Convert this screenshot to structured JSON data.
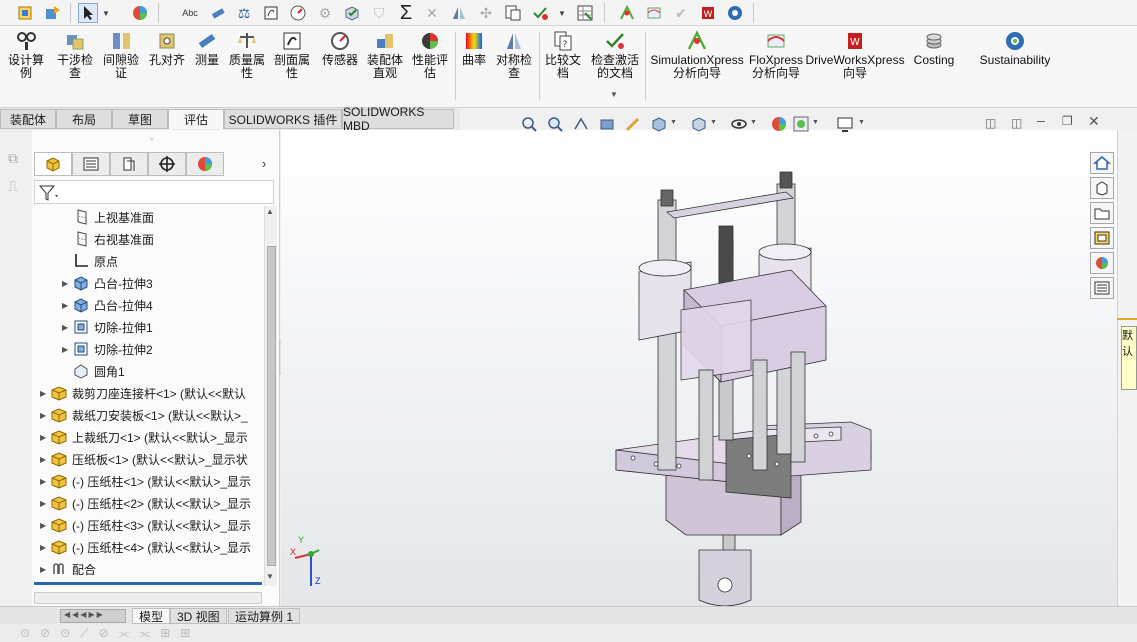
{
  "ribbon": {
    "buttons": [
      {
        "label": "设计算\n例",
        "icon": "design-study-icon"
      },
      {
        "label": "干涉检\n查",
        "icon": "interference-detection-icon"
      },
      {
        "label": "间隙验\n证",
        "icon": "clearance-verification-icon"
      },
      {
        "label": "孔对齐",
        "icon": "hole-alignment-icon"
      },
      {
        "label": "测量",
        "icon": "measure-icon"
      },
      {
        "label": "质量属\n性",
        "icon": "mass-properties-icon"
      },
      {
        "label": "剖面属\n性",
        "icon": "section-properties-icon"
      },
      {
        "label": "传感器",
        "icon": "sensor-icon"
      },
      {
        "label": "装配体\n直观",
        "icon": "assembly-visualization-icon"
      },
      {
        "label": "性能评\n估",
        "icon": "performance-evaluation-icon"
      },
      {
        "label": "曲率",
        "icon": "curvature-icon"
      },
      {
        "label": "对称检\n查",
        "icon": "symmetry-check-icon"
      },
      {
        "label": "比较文\n档",
        "icon": "compare-documents-icon"
      },
      {
        "label": "检查激活\n的文档",
        "icon": "check-active-document-icon"
      },
      {
        "label": "SimulationXpress\n分析向导",
        "icon": "simulationxpress-icon"
      },
      {
        "label": "FloXpress\n分析向导",
        "icon": "floxpress-icon"
      },
      {
        "label": "DriveWorksXpress\n向导",
        "icon": "driveworksxpress-icon"
      },
      {
        "label": "Costing",
        "icon": "costing-icon"
      },
      {
        "label": "Sustainability",
        "icon": "sustainability-icon"
      }
    ]
  },
  "tabs": [
    {
      "label": "装配体"
    },
    {
      "label": "布局"
    },
    {
      "label": "草图"
    },
    {
      "label": "评估",
      "active": true
    },
    {
      "label": "SOLIDWORKS 插件"
    },
    {
      "label": "SOLIDWORKS MBD"
    }
  ],
  "tree": [
    {
      "label": "上视基准面",
      "icon": "plane-icon",
      "expander": false,
      "indent": 1
    },
    {
      "label": "右视基准面",
      "icon": "plane-icon",
      "expander": false,
      "indent": 1
    },
    {
      "label": "原点",
      "icon": "origin-icon",
      "expander": false,
      "indent": 1
    },
    {
      "label": "凸台-拉伸3",
      "icon": "boss-extrude-icon",
      "expander": true,
      "indent": 1
    },
    {
      "label": "凸台-拉伸4",
      "icon": "boss-extrude-icon",
      "expander": true,
      "indent": 1
    },
    {
      "label": "切除-拉伸1",
      "icon": "cut-extrude-icon",
      "expander": true,
      "indent": 1
    },
    {
      "label": "切除-拉伸2",
      "icon": "cut-extrude-icon",
      "expander": true,
      "indent": 1
    },
    {
      "label": "圆角1",
      "icon": "fillet-icon",
      "expander": false,
      "indent": 1
    },
    {
      "label": "裁剪刀座连接杆<1> (默认<<默认",
      "icon": "part-icon",
      "expander": true,
      "indent": 0
    },
    {
      "label": "裁纸刀安装板<1> (默认<<默认>_",
      "icon": "part-icon",
      "expander": true,
      "indent": 0
    },
    {
      "label": "上裁纸刀<1> (默认<<默认>_显示",
      "icon": "part-icon",
      "expander": true,
      "indent": 0
    },
    {
      "label": "压纸板<1> (默认<<默认>_显示状",
      "icon": "part-icon",
      "expander": true,
      "indent": 0
    },
    {
      "label": "(-) 压纸柱<1> (默认<<默认>_显示",
      "icon": "part-icon",
      "expander": true,
      "indent": 0
    },
    {
      "label": "(-) 压纸柱<2> (默认<<默认>_显示",
      "icon": "part-icon",
      "expander": true,
      "indent": 0
    },
    {
      "label": "(-) 压纸柱<3> (默认<<默认>_显示",
      "icon": "part-icon",
      "expander": true,
      "indent": 0
    },
    {
      "label": "(-) 压纸柱<4> (默认<<默认>_显示",
      "icon": "part-icon",
      "expander": true,
      "indent": 0
    },
    {
      "label": "配合",
      "icon": "mates-icon",
      "expander": true,
      "indent": 0
    }
  ],
  "bottom_tabs": [
    {
      "label": "模型",
      "active": true
    },
    {
      "label": "3D 视图"
    },
    {
      "label": "运动算例 1"
    }
  ],
  "triad": {
    "x": "X",
    "y": "Y",
    "z": "Z"
  },
  "tooltip_fragment": "默认",
  "colors": {
    "part_body": "#dcd2e2",
    "part_shadow": "#b9aec3",
    "accent": "#2b63b3"
  }
}
